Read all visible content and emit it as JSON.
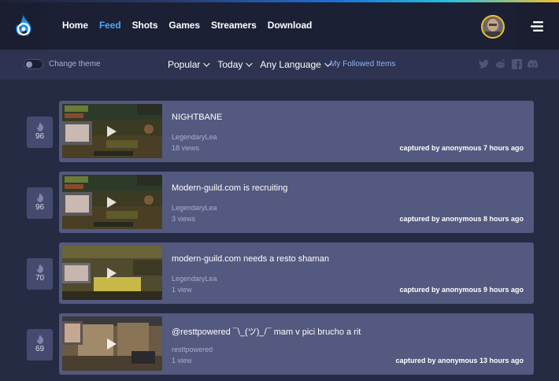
{
  "nav": {
    "links": [
      "Home",
      "Feed",
      "Shots",
      "Games",
      "Streamers",
      "Download"
    ],
    "active_index": 1
  },
  "subbar": {
    "theme_label": "Change theme",
    "filters": [
      "Popular",
      "Today",
      "Any Language"
    ],
    "followed_label": "My Followed Items",
    "socials": [
      "twitter-icon",
      "reddit-icon",
      "facebook-icon",
      "discord-icon"
    ]
  },
  "colors": {
    "accent": "#4aa8ff",
    "card": "#53597f",
    "background": "#262b44",
    "avatar_ring": "#f2c12e"
  },
  "feed": [
    {
      "score": "96",
      "title": "NIGHTBANE",
      "author": "LegendaryLea",
      "views": "18 views",
      "captured": "captured by anonymous 7 hours ago",
      "thumb": "wow"
    },
    {
      "score": "96",
      "title": "Modern-guild.com is recruiting",
      "author": "LegendaryLea",
      "views": "3 views",
      "captured": "captured by anonymous 8 hours ago",
      "thumb": "wow"
    },
    {
      "score": "70",
      "title": "modern-guild.com needs a resto shaman",
      "author": "LegendaryLea",
      "views": "1 view",
      "captured": "captured by anonymous 9 hours ago",
      "thumb": "wow2"
    },
    {
      "score": "69",
      "title": "@resttpowered ¯\\_(ツ)_/¯ mam v pici brucho a rit",
      "author": "resttpowered",
      "views": "1 view",
      "captured": "captured by anonymous 13 hours ago",
      "thumb": "cs"
    }
  ]
}
